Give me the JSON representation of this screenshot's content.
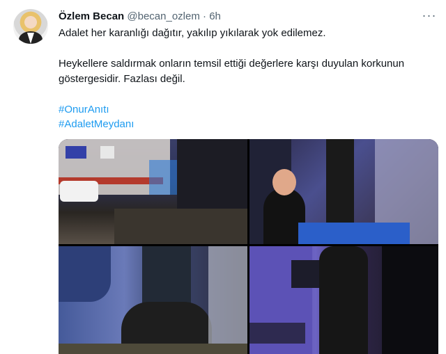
{
  "tweet": {
    "author_name": "Özlem Becan",
    "handle": "@becan_ozlem",
    "separator": "·",
    "time": "6h",
    "more_icon": "more-horizontal-icon",
    "line1": "Adalet her karanlığı dağıtır, yakılıp yıkılarak yok edilemez.",
    "line2": "Heykellere saldırmak onların temsil ettiği değerlere karşı duyulan korkunun",
    "line3": "göstergesidir. Fazlası değil.",
    "hashtags": [
      "#OnurAnıtı",
      "#AdaletMeydanı"
    ],
    "hashtag_color": "#1d9bf0"
  }
}
